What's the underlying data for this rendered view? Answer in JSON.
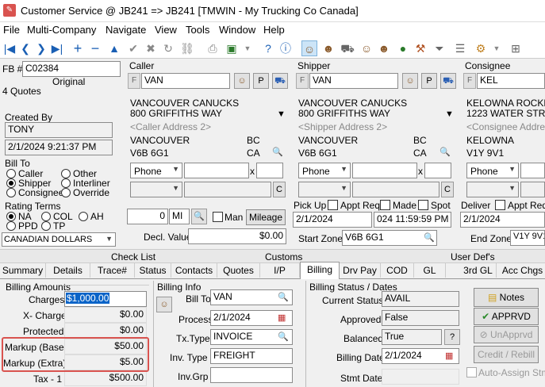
{
  "window": {
    "title": "Customer Service @ JB241 => JB241 [TMWIN - My Trucking Co Canada]"
  },
  "menu": [
    "File",
    "Multi-Company",
    "Navigate",
    "View",
    "Tools",
    "Window",
    "Help"
  ],
  "left": {
    "fb_label": "FB #",
    "fb_value": "C02384",
    "original": "Original",
    "quotes": "4 Quotes",
    "created_by_label": "Created By",
    "created_by": "TONY",
    "created_dt": "2/1/2024 9:21:37 PM",
    "bill_to_label": "Bill To",
    "bill_to_options": [
      "Caller",
      "Other",
      "Shipper",
      "Interliner",
      "Consignee",
      "Override"
    ],
    "rating_terms_label": "Rating Terms",
    "rating_options": [
      "NA",
      "COL",
      "AH",
      "PPD",
      "TP"
    ],
    "currency": "CANADIAN DOLLARS"
  },
  "caller": {
    "label": "Caller",
    "f": "F",
    "code": "VAN",
    "p": "P",
    "name": "VANCOUVER CANUCKS",
    "address1": "800 GRIFFITHS WAY",
    "address2": "<Caller Address 2>",
    "city": "VANCOUVER",
    "prov": "BC",
    "postal": "V6B 6G1",
    "country": "CA",
    "phone_label": "Phone",
    "x": "x",
    "c": "C"
  },
  "shipper": {
    "label": "Shipper",
    "f": "F",
    "code": "VAN",
    "p": "P",
    "name": "VANCOUVER CANUCKS",
    "address1": "800 GRIFFITHS WAY",
    "address2": "<Shipper Address 2>",
    "city": "VANCOUVER",
    "prov": "BC",
    "postal": "V6B 6G1",
    "country": "CA",
    "phone_label": "Phone",
    "x": "x",
    "c": "C",
    "pickup_label": "Pick Up",
    "appt_req": "Appt Req",
    "made": "Made",
    "spot": "Spot",
    "pickup_date": "2/1/2024",
    "pickup_time": "024 11:59:59 PM",
    "start_zone_label": "Start Zone",
    "start_zone": "V6B 6G1"
  },
  "consignee": {
    "label": "Consignee",
    "f": "F",
    "code": "KEL",
    "name": "KELOWNA ROCKETS",
    "address1": "1223 WATER STREE",
    "address2": "<Consignee Addres",
    "city": "KELOWNA",
    "postal": "V1Y 9V1",
    "phone_label": "Phone",
    "deliver_label": "Deliver",
    "appt_req": "Appt Req",
    "deliver_date": "2/1/2024",
    "end_zone_label": "End Zone",
    "end_zone": "V1Y 9V1"
  },
  "mileage": {
    "value": "0",
    "unit": "MI",
    "man": "Man",
    "button": "Mileage",
    "decl_label": "Decl. Value",
    "decl_value": "$0.00"
  },
  "section_headers": [
    "Check List",
    "Customs",
    "User Def's"
  ],
  "tabs": [
    "Summary",
    "Details",
    "Trace#",
    "Status",
    "Contacts",
    "Quotes",
    "I/P",
    "Billing",
    "Drv Pay",
    "COD",
    "GL",
    "3rd GL",
    "Acc Chgs"
  ],
  "billing_amounts": {
    "title": "Billing Amounts",
    "rows": [
      {
        "label": "Charges",
        "value": "$1,000.00"
      },
      {
        "label": "X- Charge",
        "value": "$0.00"
      },
      {
        "label": "Protected",
        "value": "$0.00"
      },
      {
        "label": "Markup (Base)",
        "value": "$50.00"
      },
      {
        "label": "Markup (Extra)",
        "value": "$5.00"
      },
      {
        "label": "Tax - 1",
        "value": "$500.00"
      }
    ]
  },
  "billing_info": {
    "title": "Billing Info",
    "bill_to_label": "Bill To",
    "bill_to": "VAN",
    "process_label": "Process",
    "process": "2/1/2024",
    "tx_type_label": "Tx.Type",
    "tx_type": "INVOICE",
    "inv_type_label": "Inv. Type",
    "inv_type": "FREIGHT",
    "inv_grp_label": "Inv.Grp",
    "inv_grp": ""
  },
  "billing_status": {
    "title": "Billing Status / Dates",
    "current_status_label": "Current Status",
    "current_status": "AVAIL",
    "approved_label": "Approved",
    "approved": "False",
    "balanced_label": "Balanced",
    "balanced": "True",
    "q": "?",
    "billing_date_label": "Billing Date",
    "billing_date": "2/1/2024",
    "stmt_date_label": "Stmt Date",
    "stmt_date": ""
  },
  "actions": {
    "notes": "Notes",
    "approve": "APPRVD",
    "unapprove": "UnApprvd",
    "credit_rebill": "Credit / Rebill",
    "auto_assign": "Auto-Assign Stmt"
  }
}
